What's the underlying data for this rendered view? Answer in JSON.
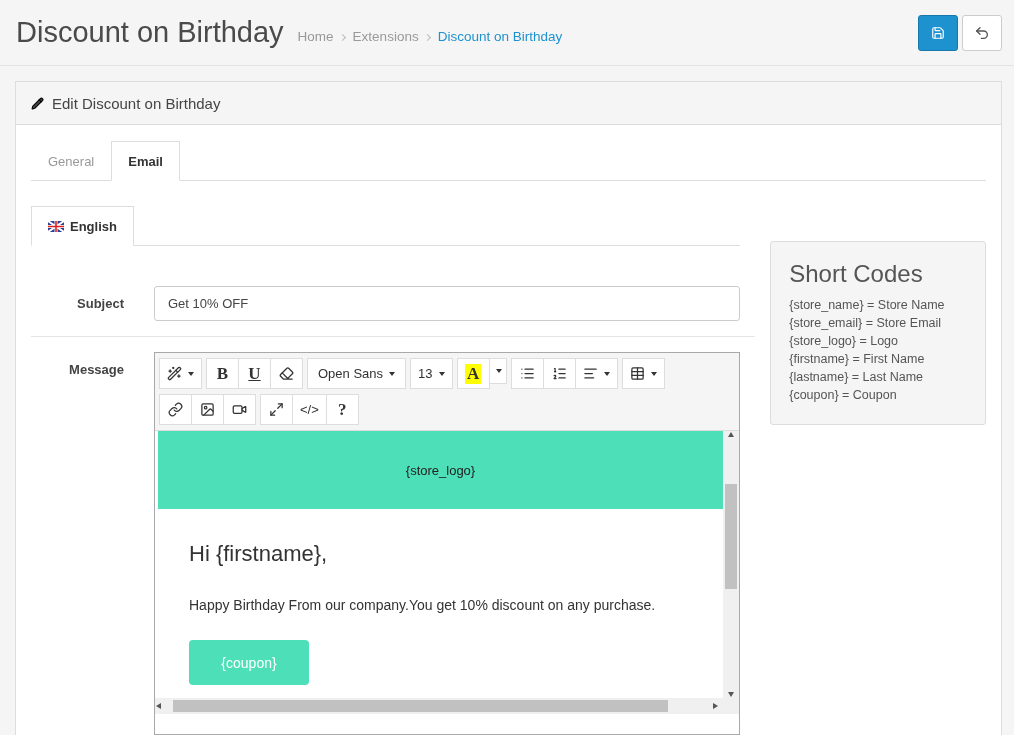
{
  "page": {
    "title": "Discount on Birthday"
  },
  "breadcrumb": [
    {
      "label": "Home",
      "selected": false
    },
    {
      "label": "Extensions",
      "selected": false
    },
    {
      "label": "Discount on Birthday",
      "selected": true
    }
  ],
  "panel": {
    "title": "Edit Discount on Birthday"
  },
  "tabs": [
    {
      "label": "General",
      "selected": false
    },
    {
      "label": "Email",
      "selected": true
    }
  ],
  "language_tabs": [
    {
      "label": "English",
      "selected": true
    }
  ],
  "subject": {
    "label": "Subject",
    "value": "Get 10% OFF"
  },
  "message": {
    "label": "Message"
  },
  "toolbar": {
    "bold": "B",
    "underline": "U",
    "font": "Open Sans",
    "size": "13",
    "highlight_letter": "A",
    "code": "</>",
    "help": "?"
  },
  "email": {
    "logo": "{store_logo}",
    "greeting": "Hi {firstname},",
    "body": "Happy Birthday From our company.You get 10% discount on any purchase.",
    "coupon": "{coupon}"
  },
  "short_codes": {
    "title": "Short Codes",
    "items": [
      "{store_name} = Store Name",
      "{store_email} = Store Email",
      "{store_logo} = Logo",
      "{firstname} = First Name",
      "{lastname} = Last Name",
      "{coupon} = Coupon"
    ]
  }
}
